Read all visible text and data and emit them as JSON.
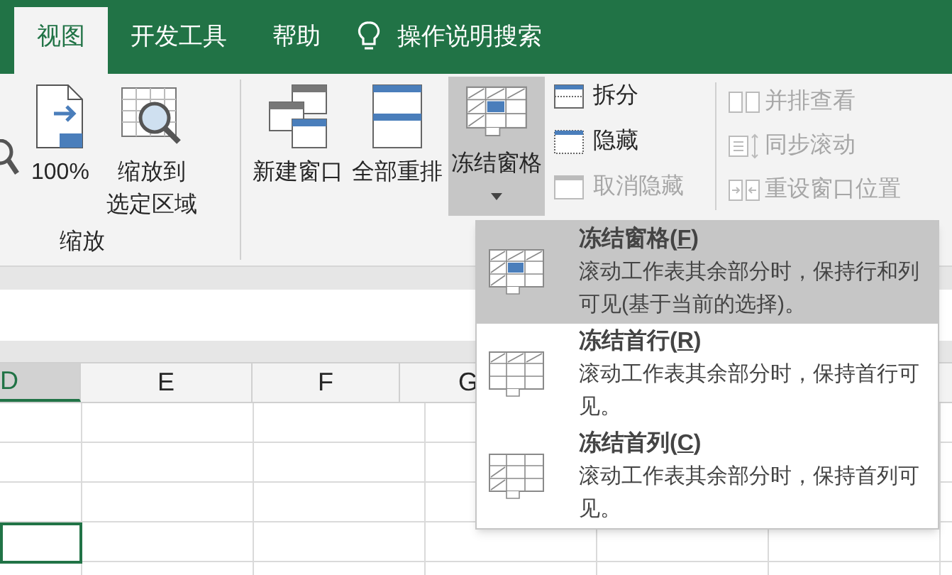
{
  "tabs": [
    {
      "label": "视图",
      "selected": true
    },
    {
      "label": "开发工具",
      "selected": false
    },
    {
      "label": "帮助",
      "selected": false
    }
  ],
  "search": {
    "label": "操作说明搜索"
  },
  "zoom_group": {
    "label": "缩放",
    "buttons": [
      {
        "lines": [
          "100%"
        ],
        "kind": "hundred"
      },
      {
        "lines": [
          "缩放到",
          "选定区域"
        ],
        "kind": "zoom-selection"
      }
    ]
  },
  "window_group": {
    "large_buttons": [
      {
        "label": "新建窗口",
        "kind": "new-window",
        "selected": false
      },
      {
        "label": "全部重排",
        "kind": "arrange",
        "selected": false
      },
      {
        "label": "冻结窗格",
        "kind": "freeze",
        "selected": true
      }
    ],
    "small_buttons": [
      {
        "label": "拆分",
        "kind": "split",
        "disabled": false
      },
      {
        "label": "隐藏",
        "kind": "hide",
        "disabled": false
      },
      {
        "label": "取消隐藏",
        "kind": "unhide",
        "disabled": true
      }
    ],
    "side_buttons": [
      {
        "label": "并排查看",
        "kind": "side-by-side",
        "disabled": true
      },
      {
        "label": "同步滚动",
        "kind": "sync-scroll",
        "disabled": true
      },
      {
        "label": "重设窗口位置",
        "kind": "reset-position",
        "disabled": true
      }
    ]
  },
  "columns": [
    {
      "label": "D",
      "selected": true
    },
    {
      "label": "E",
      "selected": false
    },
    {
      "label": "F",
      "selected": false
    },
    {
      "label": "G",
      "selected": false
    }
  ],
  "freeze_menu": [
    {
      "label_before": "冻结窗格(",
      "accelerator": "F",
      "label_after": ")",
      "description": "滚动工作表其余部分时，保持行和列可见(基于当前的选择)。",
      "kind": "panes",
      "selected": true
    },
    {
      "label_before": "冻结首行(",
      "accelerator": "R",
      "label_after": ")",
      "description": "滚动工作表其余部分时，保持首行可见。",
      "kind": "top-row",
      "selected": false
    },
    {
      "label_before": "冻结首列(",
      "accelerator": "C",
      "label_after": ")",
      "description": "滚动工作表其余部分时，保持首列可见。",
      "kind": "first-column",
      "selected": false
    }
  ]
}
